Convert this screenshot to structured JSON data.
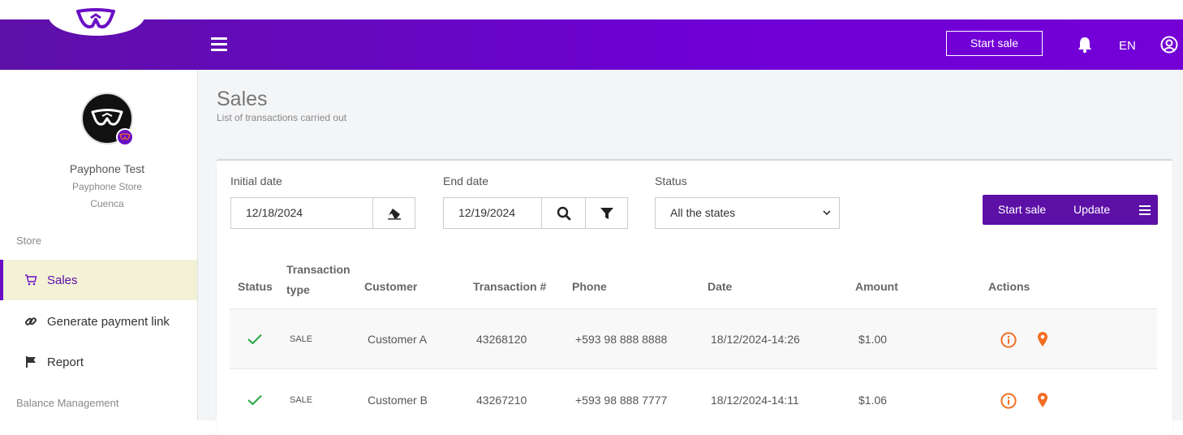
{
  "header": {
    "start_sale": "Start sale",
    "language": "EN"
  },
  "profile": {
    "name": "Payphone Test",
    "store": "Payphone Store",
    "city": "Cuenca"
  },
  "sidebar": {
    "section_store": "Store",
    "section_balance": "Balance Management",
    "items": [
      {
        "label": "Sales",
        "icon": "cart-icon"
      },
      {
        "label": "Generate payment link",
        "icon": "link-icon"
      },
      {
        "label": "Report",
        "icon": "flag-icon"
      }
    ]
  },
  "page": {
    "title": "Sales",
    "subtitle": "List of transactions carried out"
  },
  "filters": {
    "initial_date_label": "Initial date",
    "initial_date_value": "12/18/2024",
    "end_date_label": "End date",
    "end_date_value": "12/19/2024",
    "status_label": "Status",
    "status_value": "All the states"
  },
  "actions": {
    "start_sale": "Start sale",
    "update": "Update"
  },
  "table": {
    "columns": [
      "Status",
      "Transaction type",
      "Customer",
      "Transaction #",
      "Phone",
      "Date",
      "Amount",
      "Actions"
    ],
    "columns_wrapped": {
      "type_line1": "Transaction",
      "type_line2": "type"
    },
    "rows": [
      {
        "type": "SALE",
        "customer": "Customer A",
        "txn": "43268120",
        "phone": "+593 98 888 8888",
        "date": "18/12/2024-14:26",
        "amount": "$1.00"
      },
      {
        "type": "SALE",
        "customer": "Customer B",
        "txn": "43267210",
        "phone": "+593 98 888 7777",
        "date": "18/12/2024-14:11",
        "amount": "$1.06"
      }
    ]
  },
  "colors": {
    "brand": "#6a0fc4",
    "success": "#28a745",
    "action": "#f26d21"
  }
}
